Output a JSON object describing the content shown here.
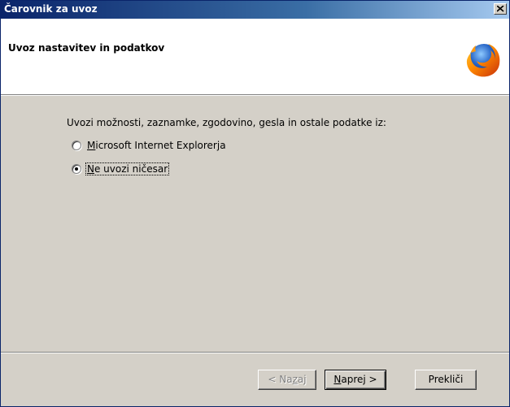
{
  "window": {
    "title": "Čarovnik za uvoz"
  },
  "header": {
    "title": "Uvoz nastavitev in podatkov",
    "logo_icon": "firefox-logo-icon"
  },
  "main": {
    "instruction": "Uvozi možnosti, zaznamke, zgodovino, gesla in ostale podatke iz:",
    "options": [
      {
        "label_mnemonic": "M",
        "label_rest": "icrosoft Internet Explorerja",
        "selected": false
      },
      {
        "label_mnemonic": "N",
        "label_rest": "e uvozi ničesar",
        "selected": true
      }
    ]
  },
  "buttons": {
    "back_prefix": "< Na",
    "back_mnemonic": "z",
    "back_suffix": "aj",
    "next_mnemonic": "N",
    "next_rest": "aprej >",
    "cancel": "Prekliči"
  },
  "colors": {
    "titlebar_start": "#0a246a",
    "titlebar_end": "#a6caf0",
    "dialog_face": "#d4d0c8"
  }
}
